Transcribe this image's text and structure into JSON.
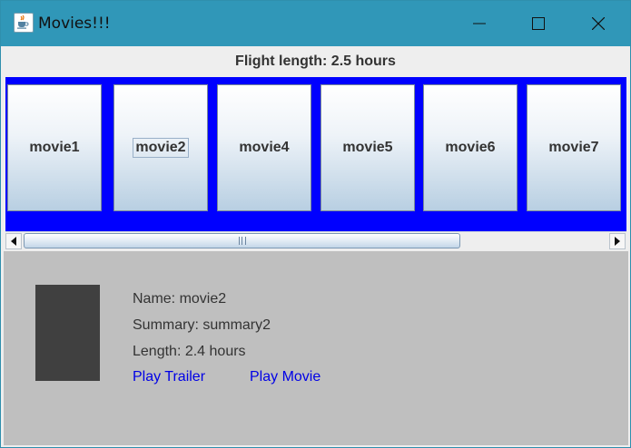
{
  "window": {
    "title": "Movies!!!",
    "icon": "java-cup-icon"
  },
  "header": {
    "flight_length": "Flight length: 2.5 hours"
  },
  "movies": [
    {
      "label": "movie1",
      "focused": false
    },
    {
      "label": "movie2",
      "focused": true
    },
    {
      "label": "movie4",
      "focused": false
    },
    {
      "label": "movie5",
      "focused": false
    },
    {
      "label": "movie6",
      "focused": false
    },
    {
      "label": "movie7",
      "focused": false
    }
  ],
  "scroll": {
    "thumb_fraction": 0.71
  },
  "details": {
    "name": "Name: movie2",
    "summary": "Summary: summary2",
    "length": "Length: 2.4 hours",
    "play_trailer": "Play Trailer",
    "play_movie": "Play Movie"
  },
  "colors": {
    "titlebar": "#3097b8",
    "strip": "#0000ff",
    "details_bg": "#bfbfbf",
    "poster": "#404040",
    "link": "#0000e6"
  }
}
